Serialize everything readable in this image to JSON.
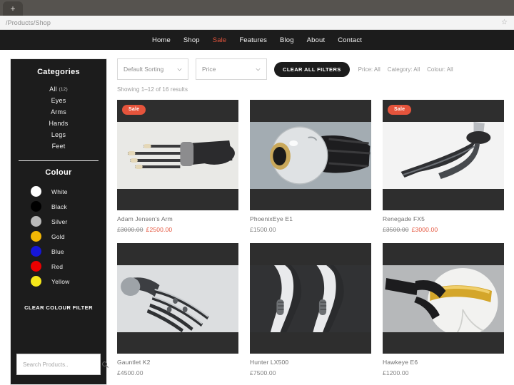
{
  "browser": {
    "new_tab_label": "+",
    "url": "/Products/Shop",
    "bookmark_icon": "star-icon"
  },
  "nav": {
    "items": [
      {
        "label": "Home",
        "active": false
      },
      {
        "label": "Shop",
        "active": false
      },
      {
        "label": "Sale",
        "active": true
      },
      {
        "label": "Features",
        "active": false
      },
      {
        "label": "Blog",
        "active": false
      },
      {
        "label": "About",
        "active": false
      },
      {
        "label": "Contact",
        "active": false
      }
    ],
    "active_color": "#e5543c"
  },
  "sidebar": {
    "categories_title": "Categories",
    "categories": [
      {
        "label": "All",
        "count": "(12)"
      },
      {
        "label": "Eyes",
        "count": ""
      },
      {
        "label": "Arms",
        "count": ""
      },
      {
        "label": "Hands",
        "count": ""
      },
      {
        "label": "Legs",
        "count": ""
      },
      {
        "label": "Feet",
        "count": ""
      }
    ],
    "colour_title": "Colour",
    "colours": [
      {
        "label": "White",
        "hex": "#ffffff"
      },
      {
        "label": "Black",
        "hex": "#000000"
      },
      {
        "label": "Silver",
        "hex": "#b9b9b9"
      },
      {
        "label": "Gold",
        "hex": "#f2b705"
      },
      {
        "label": "Blue",
        "hex": "#1616d8"
      },
      {
        "label": "Red",
        "hex": "#ec0000"
      },
      {
        "label": "Yellow",
        "hex": "#f5e71a"
      }
    ],
    "clear_colour_label": "CLEAR COLOUR FILTER",
    "search_placeholder": "Search Products..",
    "search_value": "",
    "search_icon": "search-icon"
  },
  "toolbar": {
    "sort_select": "Default Sorting",
    "price_select": "Price",
    "clear_all_label": "CLEAR ALL FILTERS",
    "filter_tags": [
      {
        "label": "Price: All"
      },
      {
        "label": "Category: All"
      },
      {
        "label": "Colour: All"
      }
    ],
    "results_text": "Showing 1–12 of 16 results"
  },
  "products": [
    {
      "title": "Adam Jensen's Arm",
      "price_old": "£3000.00",
      "price_new": "£2500.00",
      "price": "",
      "on_sale": true,
      "sale_label": "Sale",
      "art": "arm"
    },
    {
      "title": "PhoenixEye E1",
      "price_old": "",
      "price_new": "",
      "price": "£1500.00",
      "on_sale": false,
      "sale_label": "Sale",
      "art": "eye"
    },
    {
      "title": "Renegade FX5",
      "price_old": "£3500.00",
      "price_new": "£3000.00",
      "price": "",
      "on_sale": true,
      "sale_label": "Sale",
      "art": "blade"
    },
    {
      "title": "Gauntlet K2",
      "price_old": "",
      "price_new": "",
      "price": "£4500.00",
      "on_sale": false,
      "sale_label": "Sale",
      "art": "hand"
    },
    {
      "title": "Hunter LX500",
      "price_old": "",
      "price_new": "",
      "price": "£7500.00",
      "on_sale": false,
      "sale_label": "Sale",
      "art": "legs"
    },
    {
      "title": "Hawkeye E6",
      "price_old": "",
      "price_new": "",
      "price": "£1200.00",
      "on_sale": false,
      "sale_label": "Sale",
      "art": "goldeye"
    }
  ]
}
